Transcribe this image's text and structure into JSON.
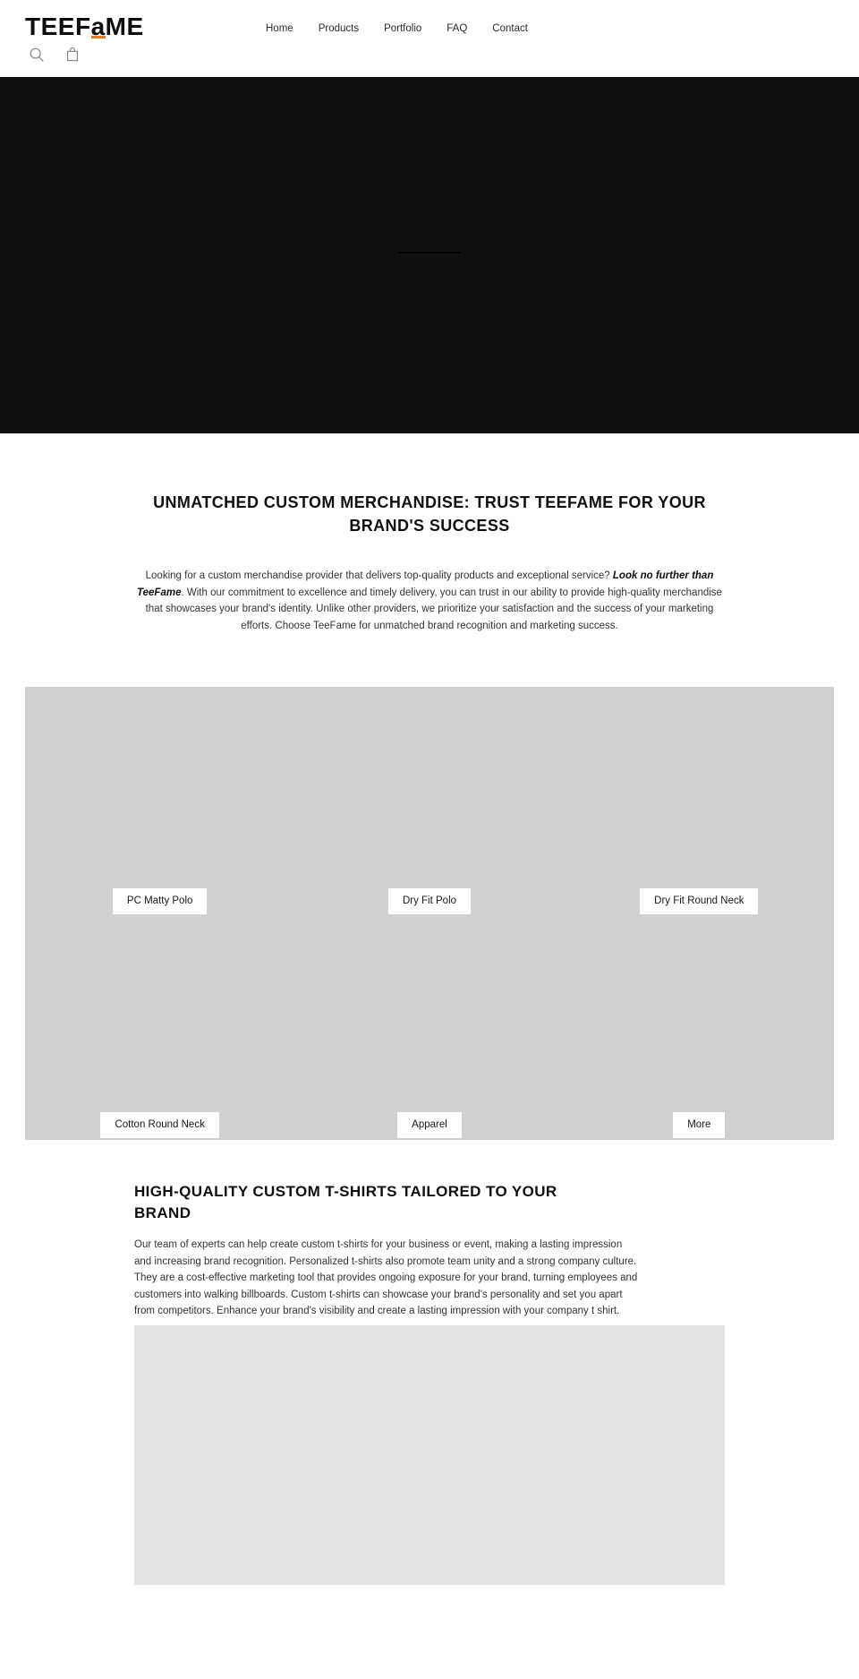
{
  "header": {
    "logo": {
      "prefix": "TEEF",
      "accent": "a",
      "suffix": "ME",
      "accent_color": "#e87722"
    },
    "icons": {
      "search": "search-icon",
      "cart": "shopping-bag-icon"
    },
    "nav": [
      {
        "label": "Home"
      },
      {
        "label": "Products"
      },
      {
        "label": "Portfolio"
      },
      {
        "label": "FAQ"
      },
      {
        "label": "Contact"
      }
    ]
  },
  "hero": {
    "background_color": "#101010",
    "rule_color": "#000000"
  },
  "intro": {
    "heading": "UNMATCHED CUSTOM MERCHANDISE: TRUST TEEFAME FOR YOUR BRAND'S SUCCESS",
    "paragraph_part1": "Looking for a custom merchandise provider that delivers top-quality products and exceptional service? ",
    "paragraph_bold": "Look no further than TeeFame",
    "paragraph_part2": ". With our commitment to excellence and timely delivery, you can trust in our ability to provide high-quality merchandise that showcases your brand's identity. Unlike other providers, we prioritize your satisfaction and the success of your marketing efforts. Choose TeeFame for unmatched brand recognition and marketing success."
  },
  "product_grid": {
    "background_color": "#d0d0d0",
    "row_top": [
      {
        "label": "PC Matty Polo"
      },
      {
        "label": "Dry Fit Polo"
      },
      {
        "label": "Dry Fit Round Neck"
      }
    ],
    "row_bottom": [
      {
        "label": "Cotton Round Neck"
      },
      {
        "label": "Apparel"
      },
      {
        "label": "More"
      }
    ]
  },
  "feature": {
    "heading": "HIGH-QUALITY CUSTOM T-SHIRTS TAILORED TO YOUR BRAND",
    "paragraph": "Our team of experts can help create custom t-shirts for your business or event, making a lasting impression and increasing brand recognition. Personalized t-shirts also promote team unity and a strong company culture. They are a cost-effective marketing tool that provides ongoing exposure for your brand, turning employees and customers into walking billboards. Custom t-shirts can showcase your brand's personality and set you apart from competitors. Enhance your brand's visibility and create a lasting impression with your company t shirt.",
    "image_color": "#e3e3e3"
  }
}
